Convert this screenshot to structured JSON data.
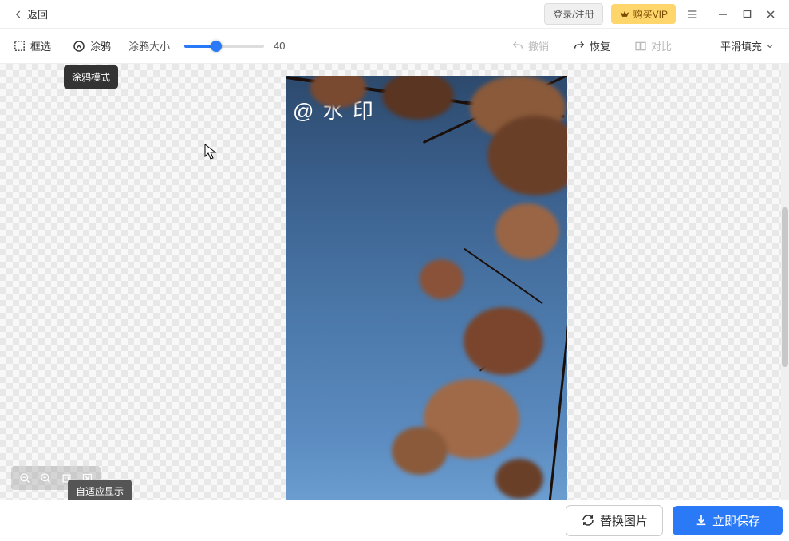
{
  "topbar": {
    "back_label": "返回",
    "login_label": "登录/注册",
    "vip_label": "购买VIP"
  },
  "toolbar": {
    "box_select_label": "框选",
    "brush_label": "涂鸦",
    "brush_size_label": "涂鸦大小",
    "brush_size_value": "40",
    "slider_percent": 40,
    "undo_label": "撤销",
    "redo_label": "恢复",
    "compare_label": "对比",
    "fill_mode_label": "平滑填充",
    "brush_tooltip": "涂鸦模式"
  },
  "canvas": {
    "watermark": "@ 水 印",
    "fit_tooltip": "自适应显示"
  },
  "bottom": {
    "replace_label": "替换图片",
    "save_label": "立即保存"
  }
}
